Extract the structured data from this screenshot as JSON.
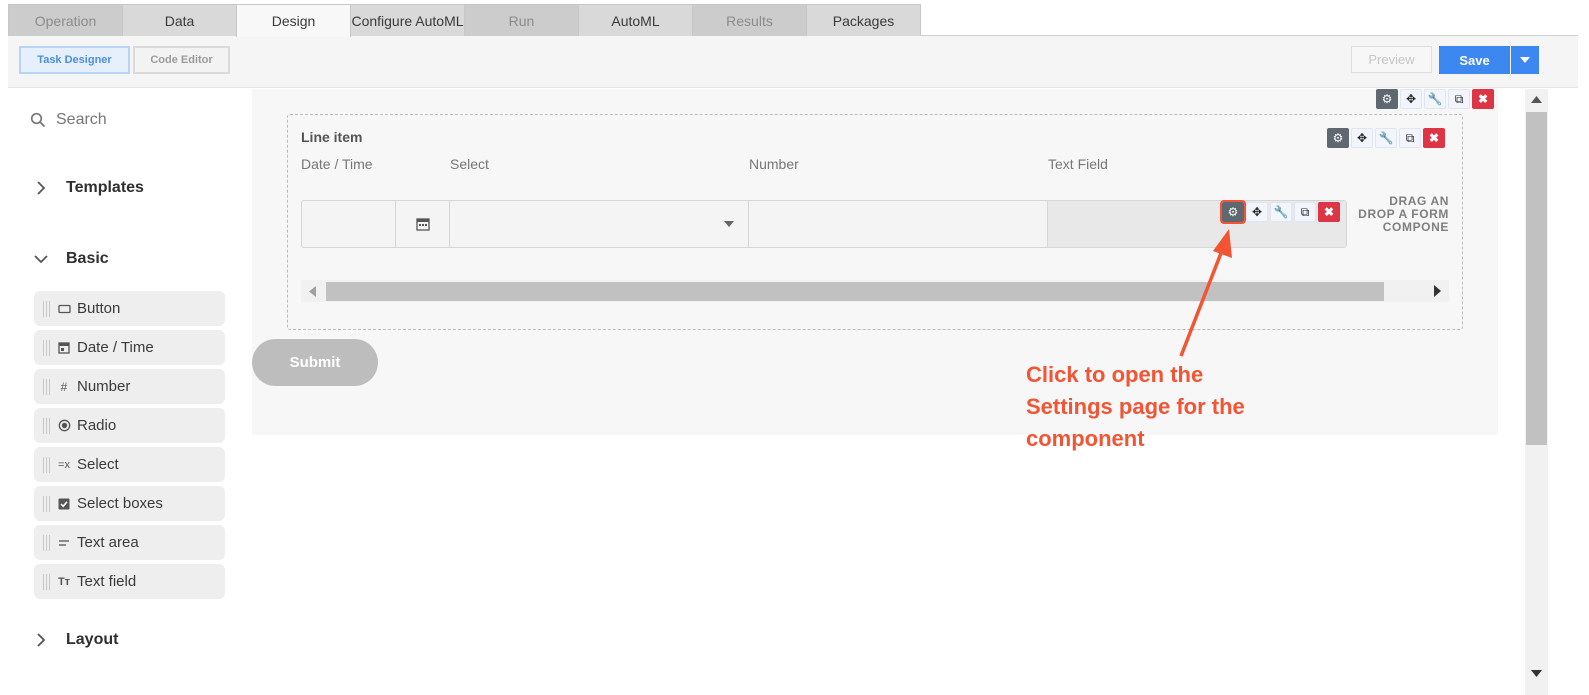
{
  "tabs": [
    {
      "label": "Operation",
      "state": "disabled"
    },
    {
      "label": "Data",
      "state": "enabled"
    },
    {
      "label": "Design",
      "state": "active"
    },
    {
      "label": "Configure AutoML",
      "state": "enabled"
    },
    {
      "label": "Run",
      "state": "disabled"
    },
    {
      "label": "AutoML",
      "state": "enabled"
    },
    {
      "label": "Results",
      "state": "disabled"
    },
    {
      "label": "Packages",
      "state": "enabled"
    }
  ],
  "toolbar": {
    "task_designer": "Task Designer",
    "code_editor": "Code Editor",
    "preview": "Preview",
    "save": "Save"
  },
  "sidebar": {
    "search_placeholder": "Search",
    "templates": "Templates",
    "basic": "Basic",
    "layout": "Layout",
    "items": [
      {
        "label": "Button",
        "icon": "button-icon"
      },
      {
        "label": "Date / Time",
        "icon": "calendar-icon"
      },
      {
        "label": "Number",
        "icon": "hash-icon"
      },
      {
        "label": "Radio",
        "icon": "radio-icon"
      },
      {
        "label": "Select",
        "icon": "select-icon"
      },
      {
        "label": "Select boxes",
        "icon": "checkbox-icon"
      },
      {
        "label": "Text area",
        "icon": "textarea-icon"
      },
      {
        "label": "Text field",
        "icon": "textfield-icon"
      }
    ]
  },
  "form": {
    "line_item_title": "Line item",
    "columns": [
      "Date / Time",
      "Select",
      "Number",
      "Text Field"
    ],
    "drop_note": "DRAG AN DROP A FORM COMPONE",
    "submit": "Submit"
  },
  "annotation": {
    "text": "Click to open the Settings page for the component",
    "color": "#f25434"
  },
  "colors": {
    "accent": "#3d87f0",
    "danger": "#dc3545"
  }
}
